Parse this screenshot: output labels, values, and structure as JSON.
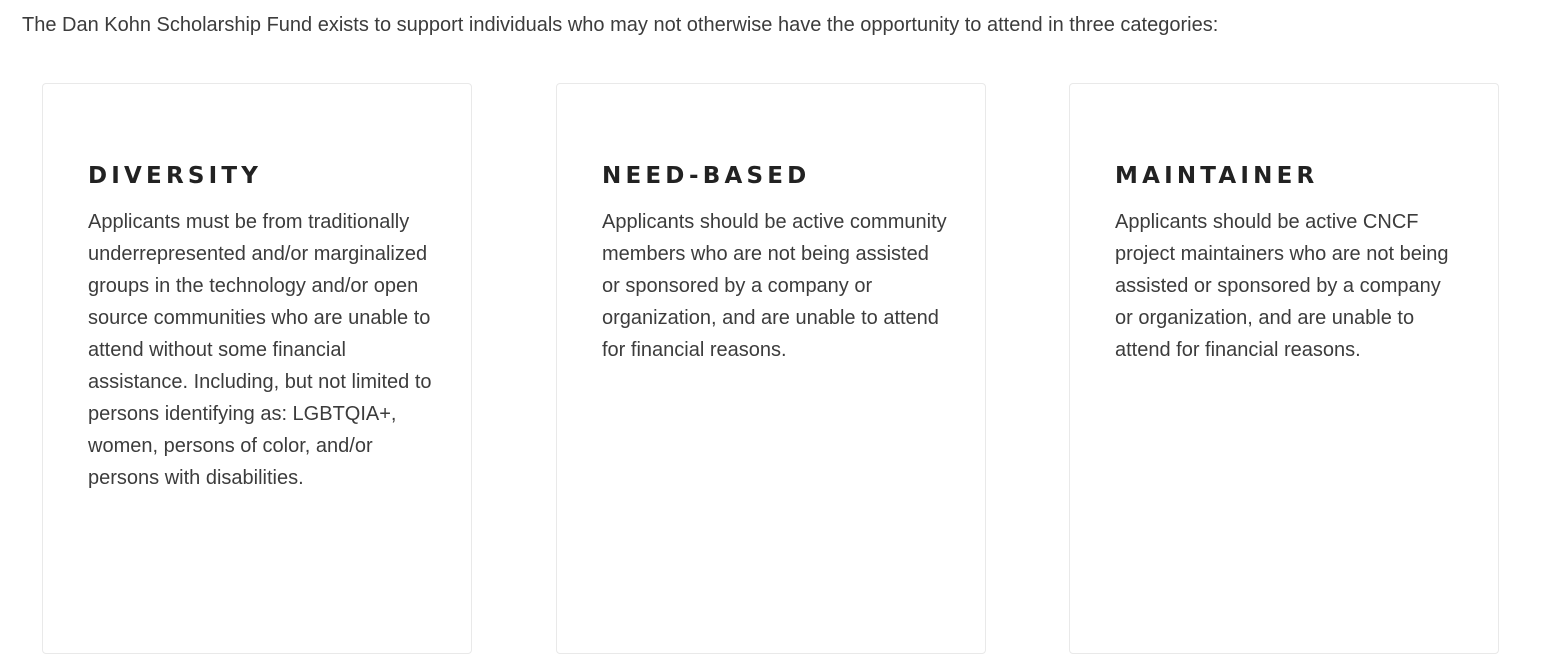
{
  "intro": {
    "text": "The Dan Kohn Scholarship Fund exists to support individuals who may not otherwise have the opportunity to attend in three categories:"
  },
  "cards": [
    {
      "title": "DIVERSITY",
      "body": "Applicants must be from traditionally underrepresented and/or marginalized groups in the technology and/or open source communities who are unable to attend without some financial assistance. Including, but not limited to persons identifying as: LGBTQIA+, women, persons of color, and/or persons with disabilities."
    },
    {
      "title": "NEED-BASED",
      "body": "Applicants should be active community members who are not being assisted or sponsored by a company or organization, and are unable to attend for financial reasons."
    },
    {
      "title": "MAINTAINER",
      "body": "Applicants should be active CNCF project maintainers who are not being assisted or sponsored by a company or organization, and are unable to attend for financial reasons."
    }
  ]
}
